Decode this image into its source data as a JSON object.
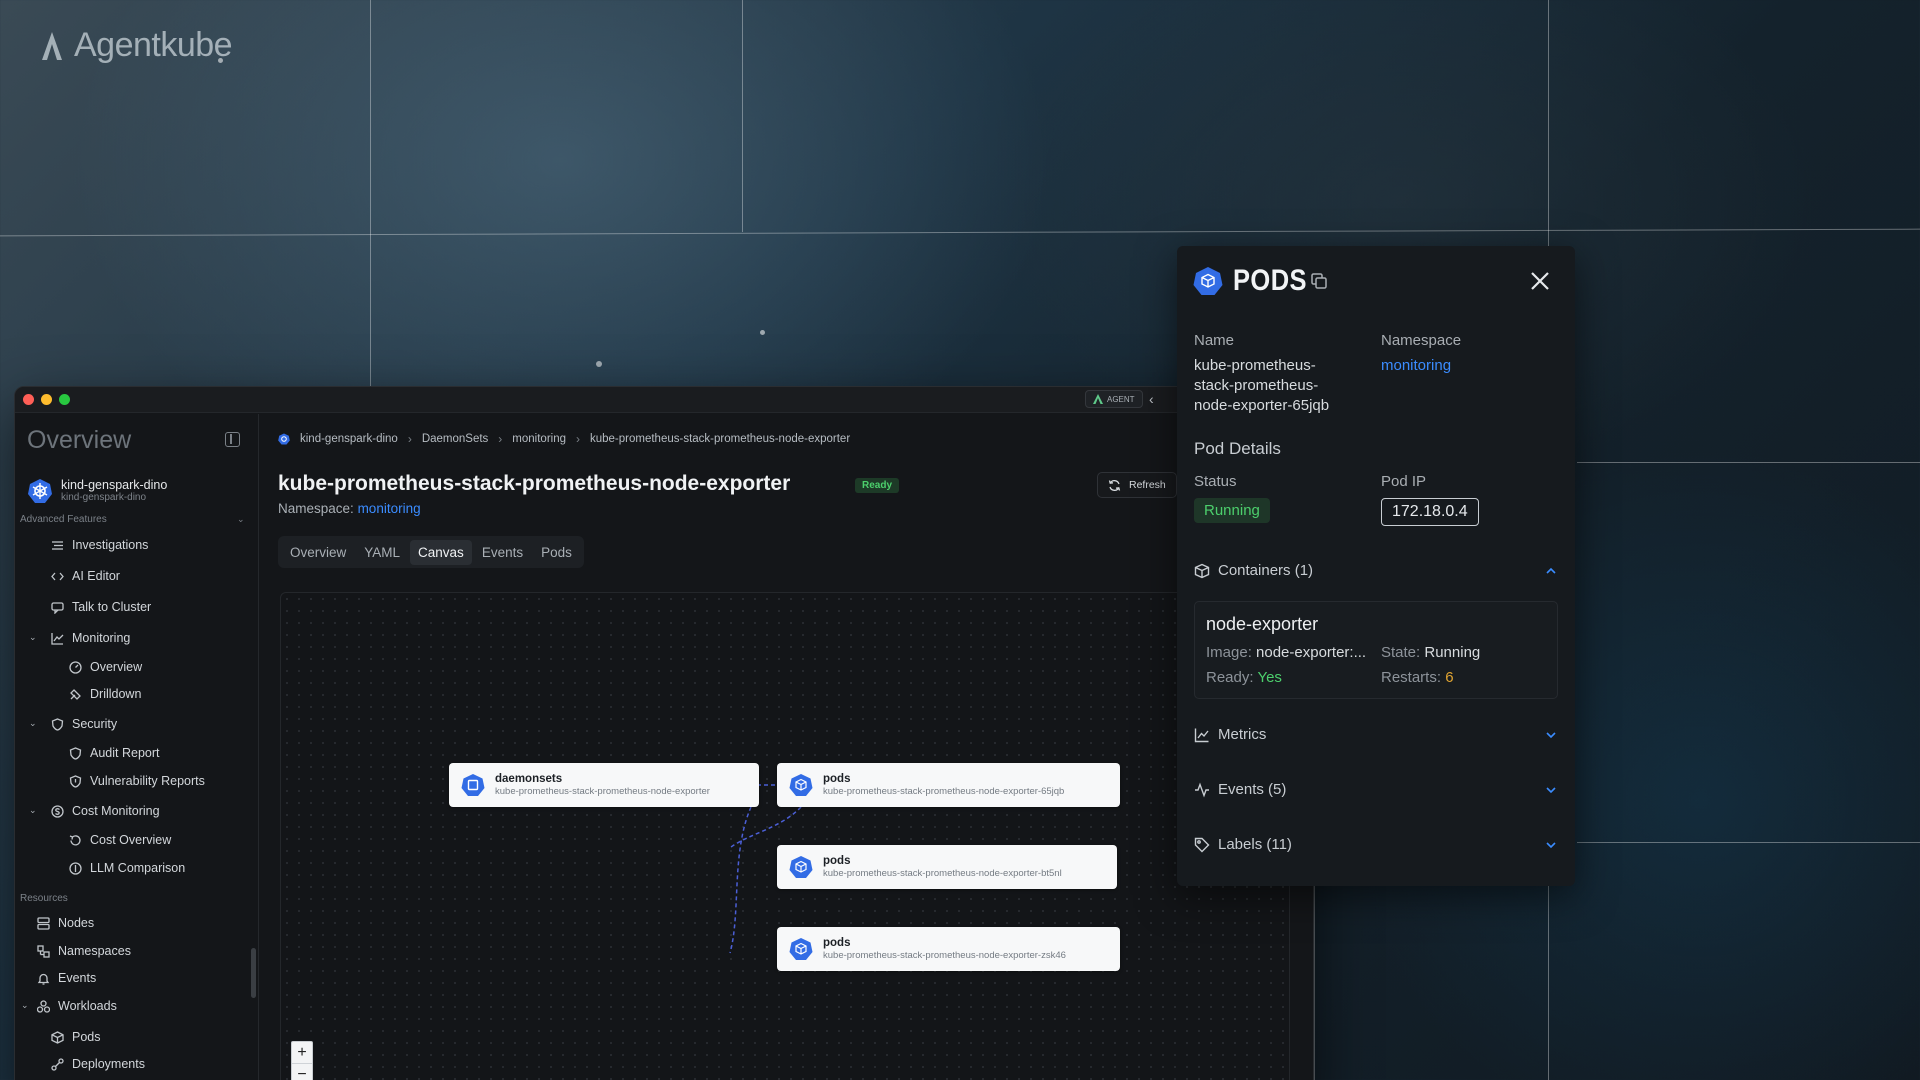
{
  "brand": {
    "name": "Agentkube"
  },
  "window": {
    "agent_label": "AGENT",
    "sidebar": {
      "title": "Overview",
      "cluster": {
        "name": "kind-genspark-dino",
        "context": "kind-genspark-dino"
      },
      "sections": {
        "advanced": "Advanced Features",
        "resources": "Resources"
      },
      "items": {
        "investigations": "Investigations",
        "ai_editor": "AI Editor",
        "talk_to_cluster": "Talk to Cluster",
        "monitoring": "Monitoring",
        "monitoring_overview": "Overview",
        "drilldown": "Drilldown",
        "security": "Security",
        "audit_report": "Audit Report",
        "vulnerability_reports": "Vulnerability Reports",
        "cost_monitoring": "Cost Monitoring",
        "cost_overview": "Cost Overview",
        "llm_comparison": "LLM Comparison",
        "nodes": "Nodes",
        "namespaces": "Namespaces",
        "events": "Events",
        "workloads": "Workloads",
        "pods": "Pods",
        "deployments": "Deployments"
      }
    },
    "main": {
      "breadcrumb": [
        "kind-genspark-dino",
        "DaemonSets",
        "monitoring",
        "kube-prometheus-stack-prometheus-node-exporter"
      ],
      "title": "kube-prometheus-stack-prometheus-node-exporter",
      "status_badge": "Ready",
      "namespace_label": "Namespace:",
      "namespace_value": "monitoring",
      "refresh_label": "Refresh",
      "tabs": [
        "Overview",
        "YAML",
        "Canvas",
        "Events",
        "Pods"
      ],
      "active_tab": "Canvas",
      "canvas": {
        "nodes": [
          {
            "kind": "daemonsets",
            "name": "kube-prometheus-stack-prometheus-node-exporter"
          },
          {
            "kind": "pods",
            "name": "kube-prometheus-stack-prometheus-node-exporter-65jqb"
          },
          {
            "kind": "pods",
            "name": "kube-prometheus-stack-prometheus-node-exporter-bt5nl"
          },
          {
            "kind": "pods",
            "name": "kube-prometheus-stack-prometheus-node-exporter-zsk46"
          }
        ],
        "zoom_in": "+",
        "zoom_out": "−"
      }
    }
  },
  "panel": {
    "title": "PODS",
    "name_label": "Name",
    "name_value": "kube-prometheus-stack-prometheus-node-exporter-65jqb",
    "name_lines": [
      "kube-prometheus-",
      "stack-prometheus-",
      "node-exporter-65jqb"
    ],
    "namespace_label": "Namespace",
    "namespace_value": "monitoring",
    "pod_details_heading": "Pod Details",
    "status_label": "Status",
    "status_value": "Running",
    "pod_ip_label": "Pod IP",
    "pod_ip_value": "172.18.0.4",
    "containers_label": "Containers (1)",
    "container": {
      "name": "node-exporter",
      "image_label": "Image:",
      "image_value": "node-exporter:...",
      "state_label": "State:",
      "state_value": "Running",
      "ready_label": "Ready:",
      "ready_value": "Yes",
      "restarts_label": "Restarts:",
      "restarts_value": "6"
    },
    "metrics_label": "Metrics",
    "events_label": "Events (5)",
    "labels_label": "Labels (11)"
  },
  "colors": {
    "accent_blue": "#3b8cff",
    "status_green": "#4ccf6c",
    "restart_amber": "#e0a431",
    "k8s_blue": "#326ce5"
  }
}
